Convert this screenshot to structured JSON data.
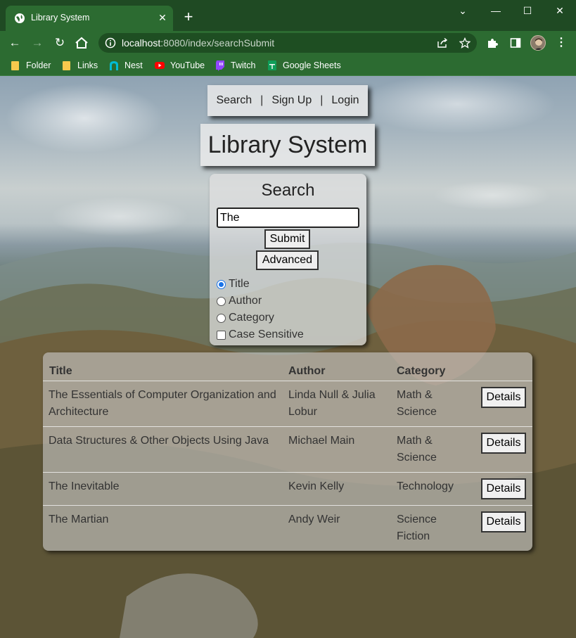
{
  "browser": {
    "tab_title": "Library System",
    "url_host": "localhost",
    "url_rest": ":8080/index/searchSubmit",
    "bookmarks": [
      {
        "label": "Folder",
        "icon": "folder-icon",
        "color": "#f6c94d"
      },
      {
        "label": "Links",
        "icon": "folder-icon",
        "color": "#f6c94d"
      },
      {
        "label": "Nest",
        "icon": "nest-icon",
        "color": "#00bcd4"
      },
      {
        "label": "YouTube",
        "icon": "youtube-icon",
        "color": "#ff0000"
      },
      {
        "label": "Twitch",
        "icon": "twitch-icon",
        "color": "#9146ff"
      },
      {
        "label": "Google Sheets",
        "icon": "sheets-icon",
        "color": "#0f9d58"
      }
    ]
  },
  "nav": {
    "search": "Search",
    "separator": "|",
    "signup": "Sign Up",
    "login": "Login"
  },
  "app_title": "Library System",
  "search": {
    "title": "Search",
    "query": "The",
    "submit": "Submit",
    "advanced": "Advanced",
    "options": [
      {
        "label": "Title",
        "checked": true
      },
      {
        "label": "Author",
        "checked": false
      },
      {
        "label": "Category",
        "checked": false
      }
    ],
    "case_sensitive": {
      "label": "Case Sensitive",
      "checked": false
    }
  },
  "results": {
    "headers": [
      "Title",
      "Author",
      "Category"
    ],
    "details_label": "Details",
    "rows": [
      {
        "title": "The Essentials of Computer Organization and Architecture",
        "author": "Linda Null & Julia Lobur",
        "category": "Math & Science"
      },
      {
        "title": "Data Structures & Other Objects Using Java",
        "author": "Michael Main",
        "category": "Math & Science"
      },
      {
        "title": "The Inevitable",
        "author": "Kevin Kelly",
        "category": "Technology"
      },
      {
        "title": "The Martian",
        "author": "Andy Weir",
        "category": "Science Fiction"
      }
    ]
  }
}
